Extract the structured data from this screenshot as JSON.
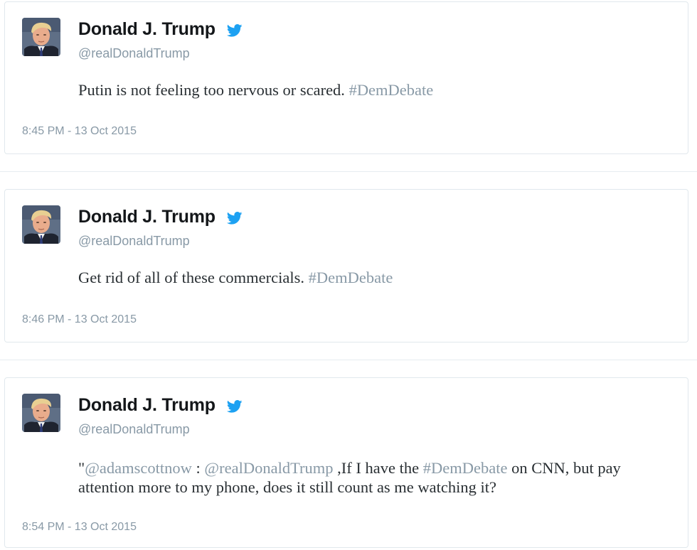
{
  "colors": {
    "border": "#e1e8ed",
    "name": "#14171a",
    "muted": "#8899a6",
    "text": "#292f33",
    "twitter_blue": "#1da1f2"
  },
  "icons": {
    "verified": "twitter-bird-icon",
    "avatar": "profile-photo"
  },
  "tweets": [
    {
      "author": "Donald J. Trump",
      "handle": "@realDonaldTrump",
      "text": "Putin is not feeling too nervous or scared.",
      "hashtag": "#DemDebate",
      "timestamp": "8:45 PM - 13 Oct 2015"
    },
    {
      "author": "Donald J. Trump",
      "handle": "@realDonaldTrump",
      "text": "Get rid of all of these commercials.",
      "hashtag": "#DemDebate",
      "timestamp": "8:46 PM - 13 Oct 2015"
    },
    {
      "author": "Donald J. Trump",
      "handle": "@realDonaldTrump",
      "quote_open": "\"",
      "mention_1": "@adamscottnow",
      "sep": " : ",
      "mention_2": "@realDonaldTrump",
      "text_a": " ,If I have the ",
      "hashtag": "#DemDebate",
      "text_b": " on CNN, but pay attention more to my phone, does it still count as me watching it?",
      "timestamp": "8:54 PM - 13 Oct 2015"
    }
  ]
}
